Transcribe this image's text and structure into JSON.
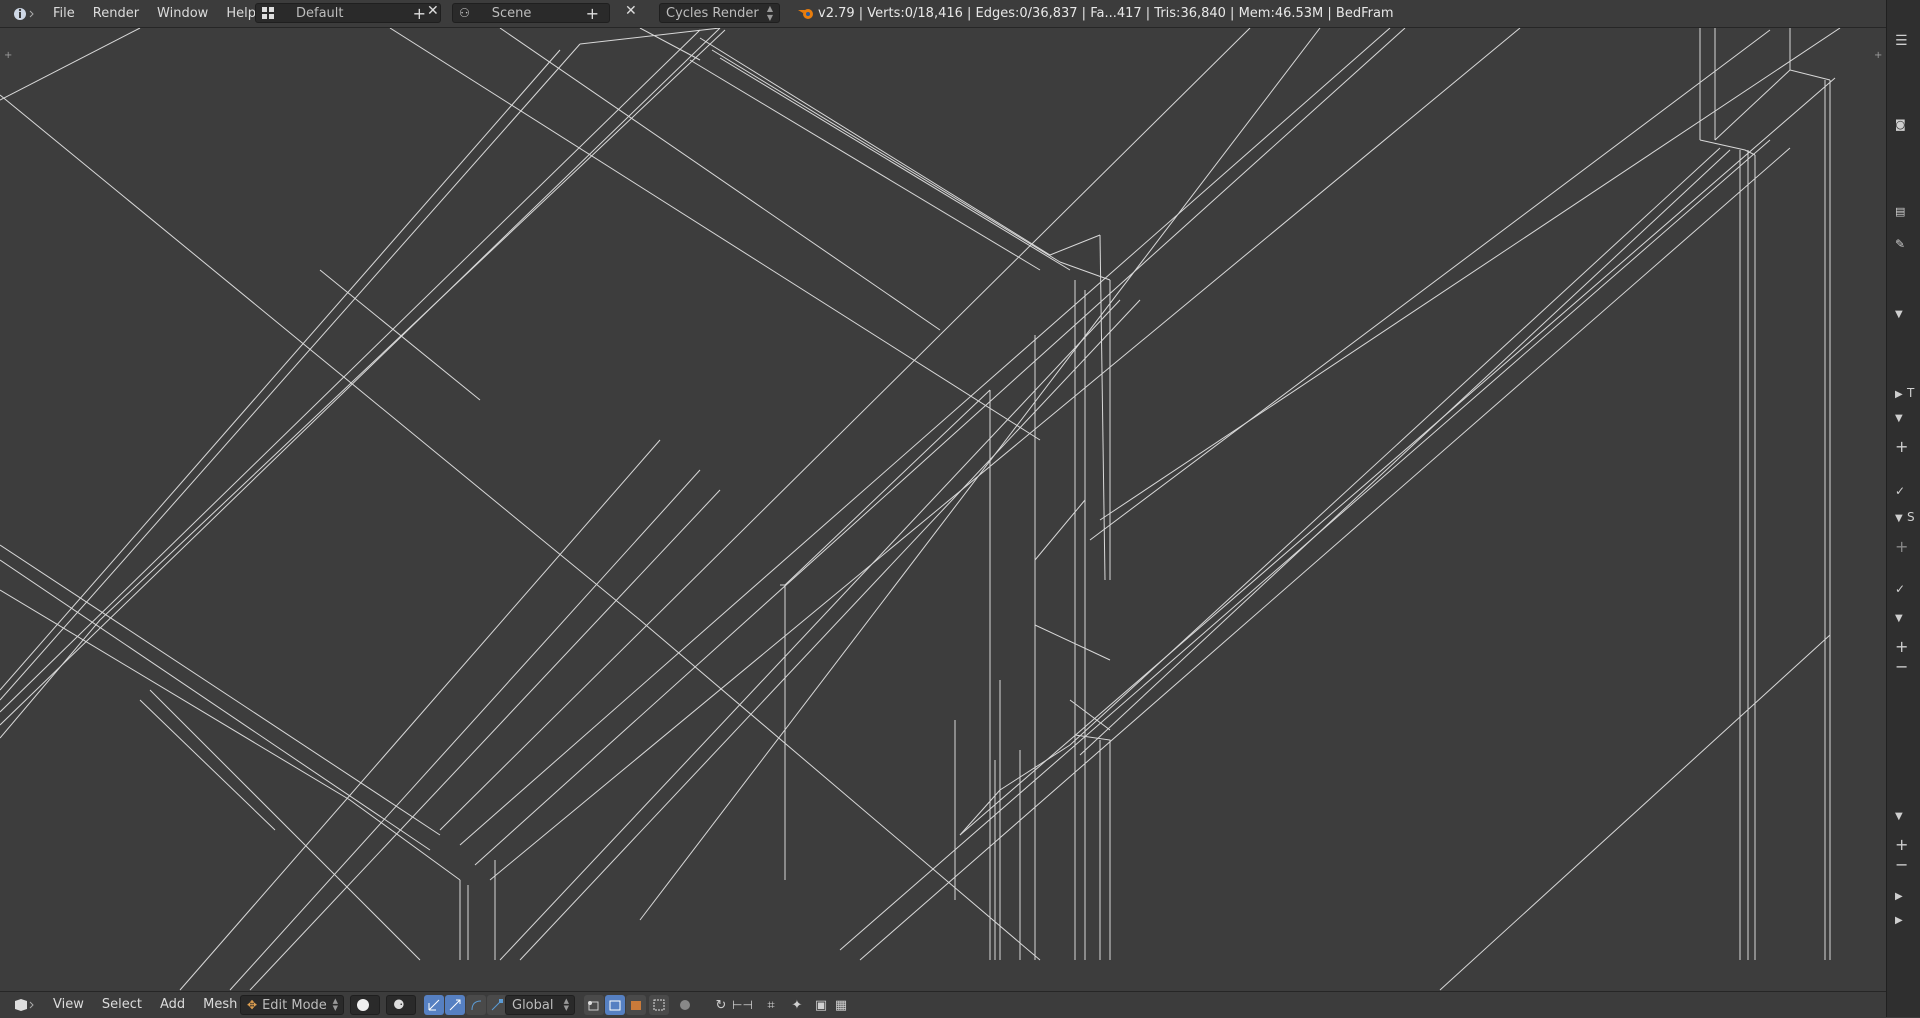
{
  "topbar": {
    "menus": [
      "File",
      "Render",
      "Window",
      "Help"
    ],
    "screen_layout": "Default",
    "scene": "Scene",
    "render_engine": "Cycles Render",
    "stats": "v2.79 | Verts:0/18,416 | Edges:0/36,837 | Fa...417 | Tris:36,840 | Mem:46.53M | BedFram"
  },
  "bottombar": {
    "menus": [
      "View",
      "Select",
      "Add",
      "Mesh"
    ],
    "mode": "Edit Mode",
    "orientation": "Global"
  },
  "rightstrip": {
    "tab_letters": [
      "T",
      "S"
    ]
  },
  "colors": {
    "viewport_bg": "#3d3d3d",
    "wire": "#e6e6e6",
    "header_bg": "#3c3c3c",
    "accent": "#5680c2"
  }
}
